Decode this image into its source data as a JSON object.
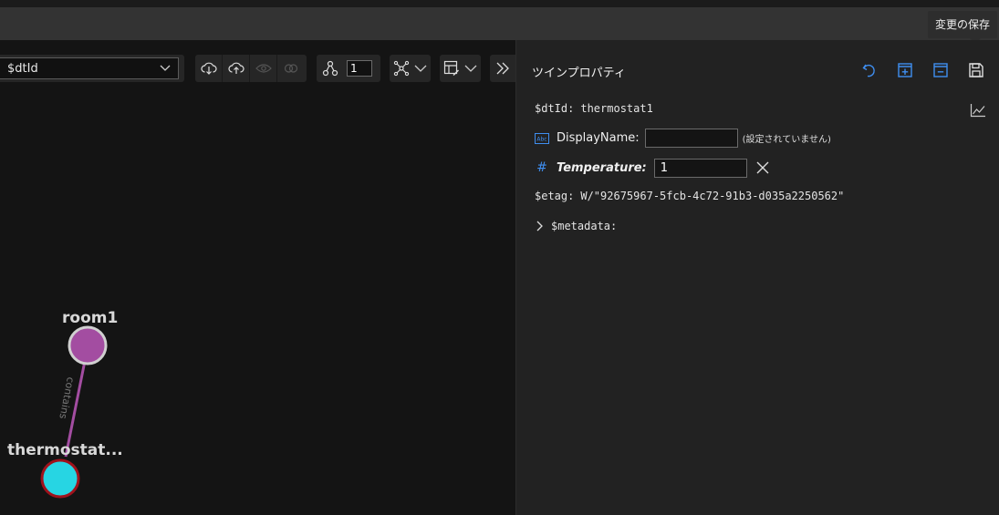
{
  "tooltip": {
    "save_changes": "変更の保存"
  },
  "graph_toolbar": {
    "query_select_value": "$dtId",
    "layer_count": "1"
  },
  "graph": {
    "nodes": [
      {
        "label": "room1",
        "color": "#a34da1",
        "border": "#d0d0d0"
      },
      {
        "label": "thermostat...",
        "color": "#27d5e3",
        "border": "#a0121c"
      }
    ],
    "edge": {
      "label": "contains",
      "color": "#a34da1"
    }
  },
  "panel": {
    "title": "ツインプロパティ",
    "dtid_label": "$dtId:",
    "dtid_value": "thermostat1",
    "display_name_label": "DisplayName:",
    "display_name_value": "",
    "display_name_note": "(設定されていません)",
    "temperature_label": "Temperature:",
    "temperature_value": "1",
    "etag_label": "$etag:",
    "etag_value": "W/\"92675967-5fcb-4c72-91b3-d035a2250562\"",
    "metadata_label": "$metadata:"
  },
  "colors": {
    "accent": "#3f8ef0",
    "panel_bg": "#222222",
    "graph_bg": "#141414"
  }
}
